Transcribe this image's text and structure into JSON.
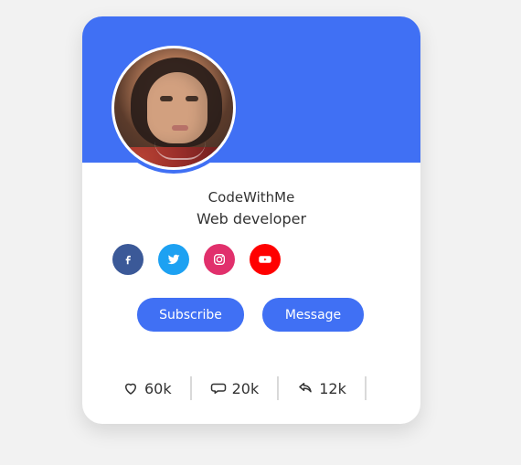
{
  "colors": {
    "primary": "#4070f4",
    "facebook": "#3b5998",
    "twitter": "#1da1f2",
    "instagram": "#e1306c",
    "youtube": "#ff0000"
  },
  "profile": {
    "name": "CodeWithMe",
    "title": "Web developer"
  },
  "social_links": [
    {
      "icon": "facebook-icon"
    },
    {
      "icon": "twitter-icon"
    },
    {
      "icon": "instagram-icon"
    },
    {
      "icon": "youtube-icon"
    }
  ],
  "buttons": {
    "subscribe": "Subscribe",
    "message": "Message"
  },
  "stats": {
    "likes": {
      "icon": "heart-icon",
      "value": "60k"
    },
    "comments": {
      "icon": "comment-icon",
      "value": "20k"
    },
    "shares": {
      "icon": "share-icon",
      "value": "12k"
    }
  }
}
